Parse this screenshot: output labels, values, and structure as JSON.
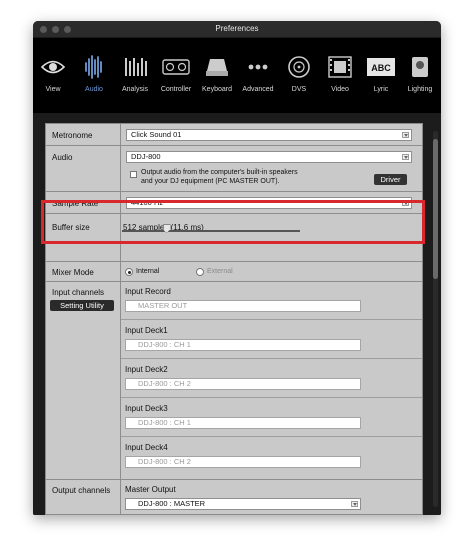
{
  "window": {
    "title": "Preferences"
  },
  "toolbar": {
    "items": [
      {
        "label": "View",
        "icon": "eye-icon"
      },
      {
        "label": "Audio",
        "icon": "audio-waveform-icon",
        "active": true
      },
      {
        "label": "Analysis",
        "icon": "analysis-bars-icon"
      },
      {
        "label": "Controller",
        "icon": "controller-icon"
      },
      {
        "label": "Keyboard",
        "icon": "keyboard-icon"
      },
      {
        "label": "Advanced",
        "icon": "advanced-dots-icon"
      },
      {
        "label": "DVS",
        "icon": "vinyl-icon"
      },
      {
        "label": "Video",
        "icon": "film-icon"
      },
      {
        "label": "Lyric",
        "icon": "lyric-abc-icon"
      },
      {
        "label": "Lighting",
        "icon": "lighting-icon"
      }
    ]
  },
  "metronome": {
    "label": "Metronome",
    "value": "Click Sound 01"
  },
  "audio": {
    "label": "Audio",
    "device": "DDJ-800",
    "checkbox_line1": "Output audio from the computer's built-in speakers",
    "checkbox_line2": "and your DJ equipment (PC MASTER OUT).",
    "driver_button": "Driver"
  },
  "sample_rate": {
    "label": "Sample Rate",
    "value": "44100 Hz"
  },
  "buffer_size": {
    "label": "Buffer size",
    "value": "512 samples (11.6 ms)",
    "slider_fraction": 0.25,
    "highlight_color": "#d9272e"
  },
  "mixer_mode": {
    "label": "Mixer Mode",
    "internal": "Internal",
    "external": "External",
    "selected": "Internal"
  },
  "input_channels": {
    "label": "Input channels",
    "button": "Setting Utility",
    "groups": [
      {
        "title": "Input Record",
        "value": "MASTER OUT"
      },
      {
        "title": "Input Deck1",
        "value": "DDJ-800 : CH 1"
      },
      {
        "title": "Input Deck2",
        "value": "DDJ-800 : CH 2"
      },
      {
        "title": "Input Deck3",
        "value": "DDJ-800 : CH 1"
      },
      {
        "title": "Input Deck4",
        "value": "DDJ-800 : CH 2"
      }
    ]
  },
  "output_channels": {
    "label": "Output channels",
    "master_title": "Master Output",
    "master_value": "DDJ-800 : MASTER"
  },
  "colors": {
    "toolbar_bg": "#000000",
    "panel_bg": "#c9c9c9",
    "accent": "#6f9ad8"
  }
}
